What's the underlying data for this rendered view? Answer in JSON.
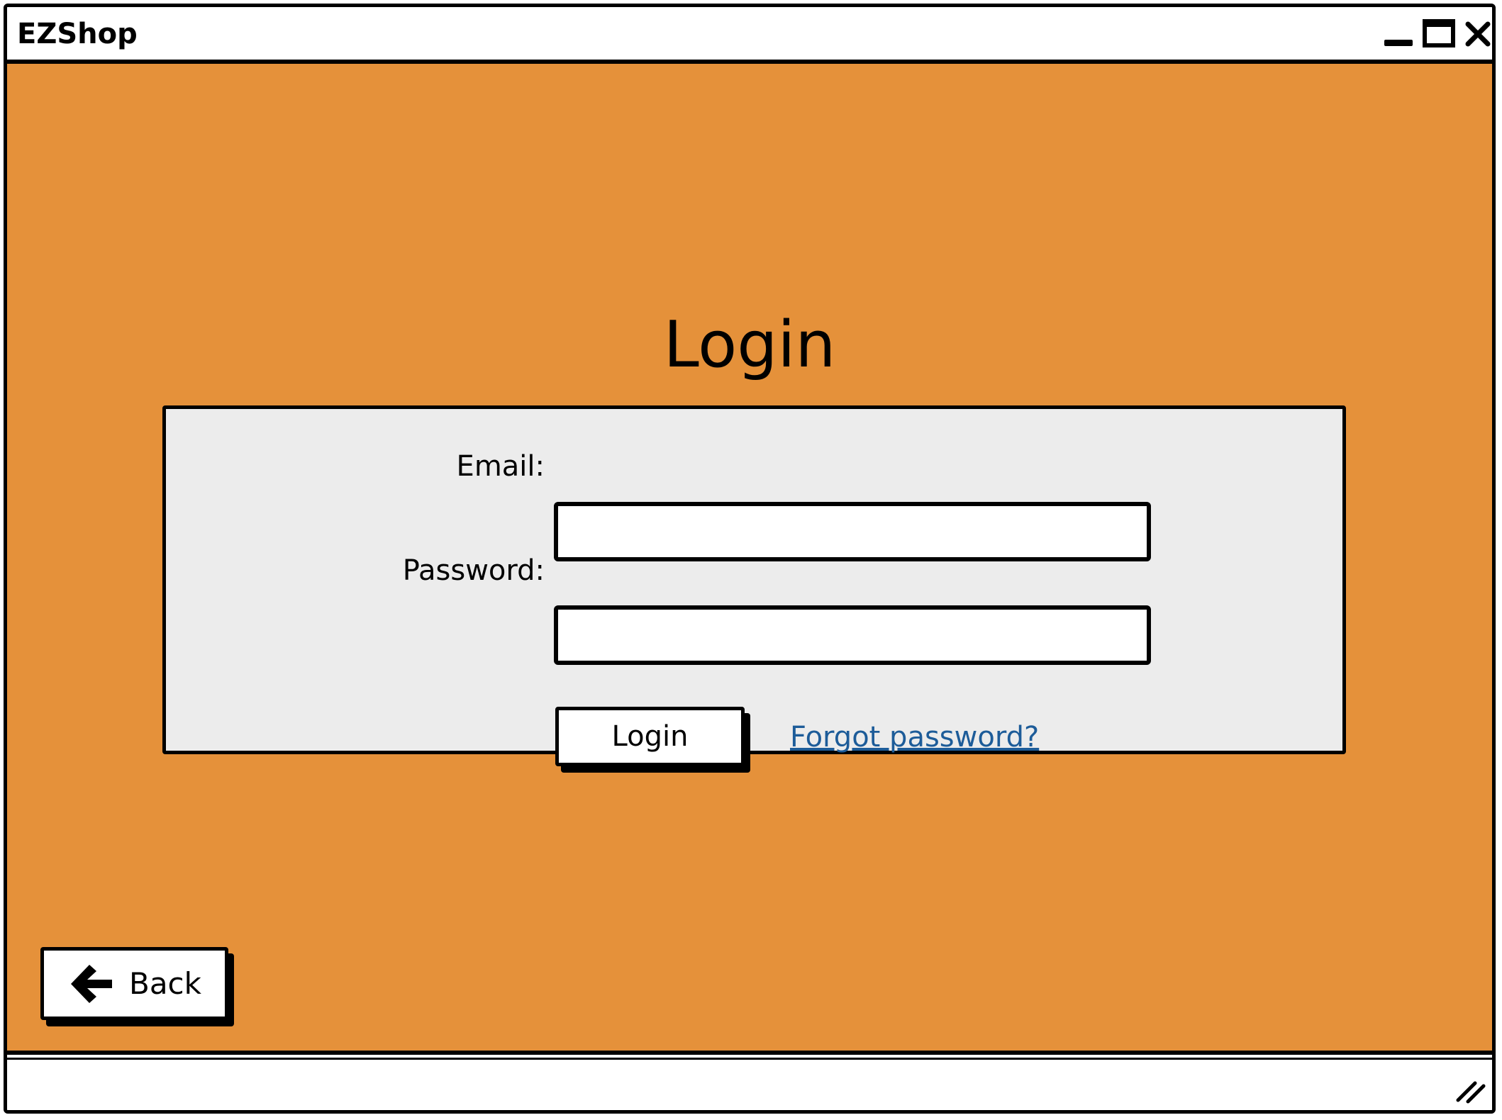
{
  "window": {
    "title": "EZShop",
    "controls": {
      "minimize_icon": "minimize-icon",
      "maximize_icon": "maximize-icon",
      "close_icon": "close-icon"
    }
  },
  "page": {
    "title": "Login",
    "background_color": "#e5913a"
  },
  "form": {
    "email_label": "Email:",
    "email_value": "",
    "password_label": "Password:",
    "password_value": "",
    "login_button_label": "Login",
    "forgot_password_link": "Forgot password?"
  },
  "navigation": {
    "back_button_label": "Back",
    "back_icon": "arrow-left-icon"
  },
  "statusbar": {
    "resize_icon": "resize-grip-icon"
  },
  "colors": {
    "accent": "#e5913a",
    "panel": "#ececec",
    "link": "#1d5c99"
  }
}
